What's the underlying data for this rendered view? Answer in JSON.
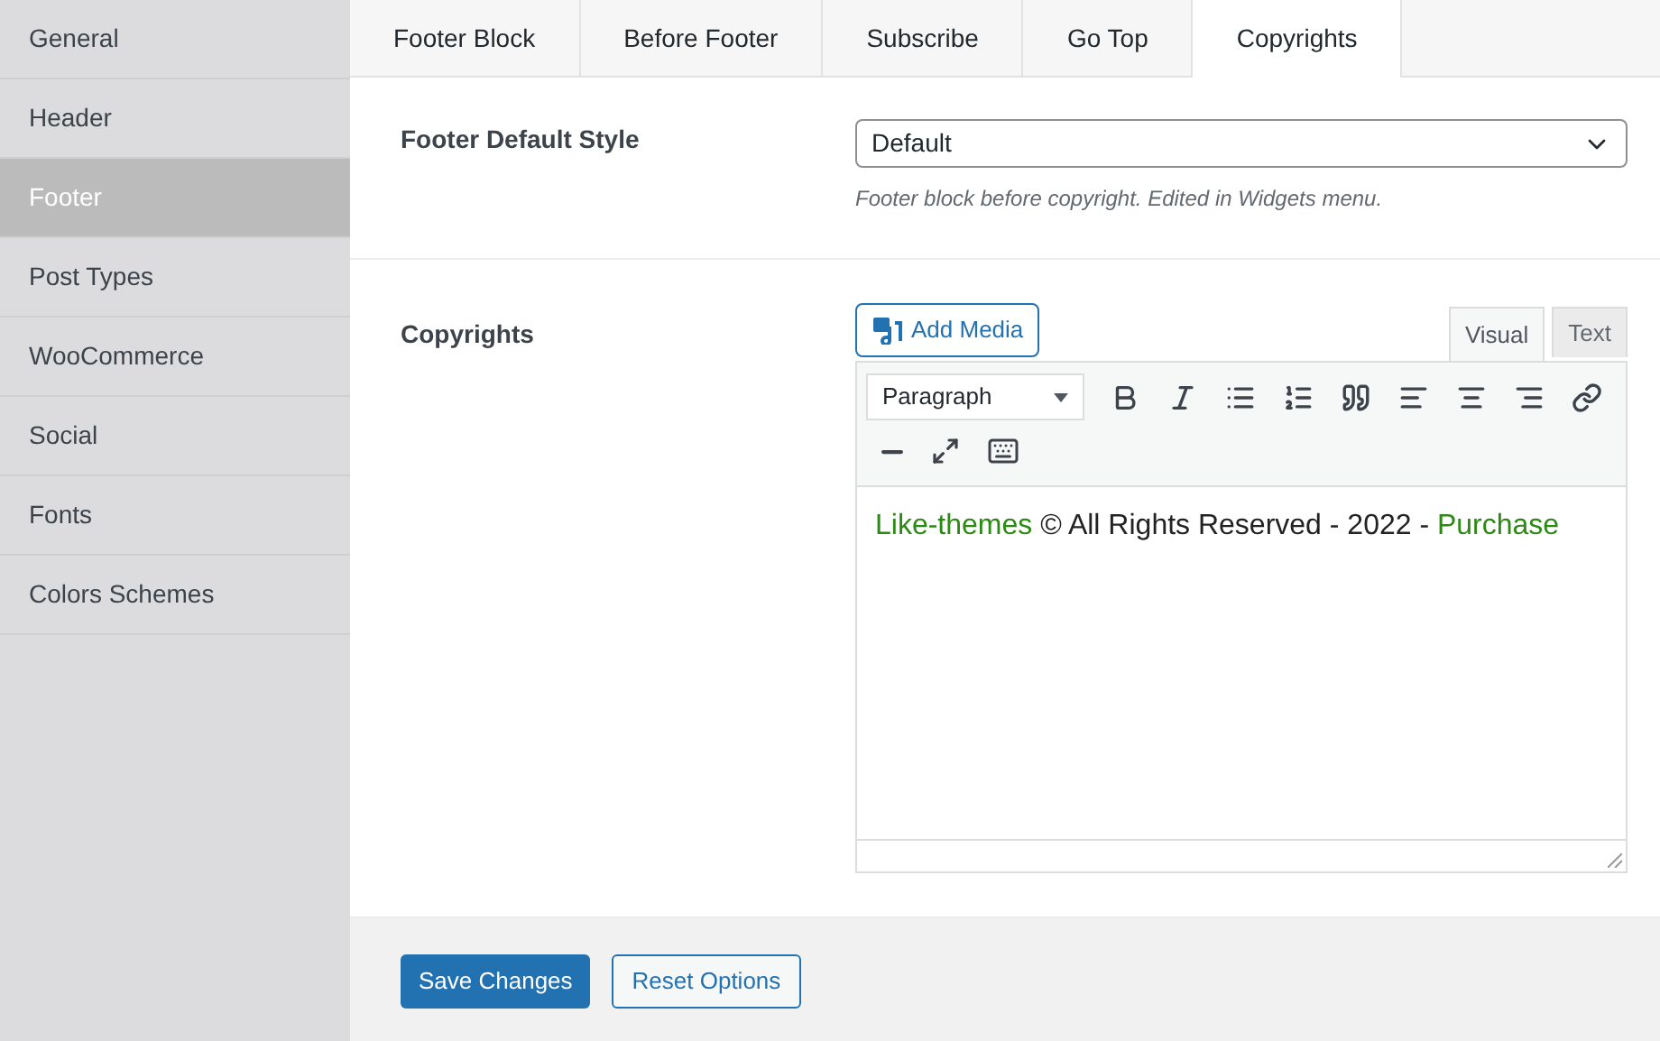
{
  "sidebar": {
    "items": [
      {
        "label": "General",
        "selected": false
      },
      {
        "label": "Header",
        "selected": false
      },
      {
        "label": "Footer",
        "selected": true
      },
      {
        "label": "Post Types",
        "selected": false
      },
      {
        "label": "WooCommerce",
        "selected": false
      },
      {
        "label": "Social",
        "selected": false
      },
      {
        "label": "Fonts",
        "selected": false
      },
      {
        "label": "Colors Schemes",
        "selected": false
      }
    ]
  },
  "tabs": [
    {
      "label": "Footer Block",
      "selected": false
    },
    {
      "label": "Before Footer",
      "selected": false
    },
    {
      "label": "Subscribe",
      "selected": false
    },
    {
      "label": "Go Top",
      "selected": false
    },
    {
      "label": "Copyrights",
      "selected": true
    }
  ],
  "footer_default_style": {
    "label": "Footer Default Style",
    "value": "Default",
    "description": "Footer block before copyright. Edited in Widgets menu."
  },
  "copyrights": {
    "label": "Copyrights",
    "add_media": "Add Media",
    "editor_tabs": [
      {
        "label": "Visual",
        "selected": true
      },
      {
        "label": "Text",
        "selected": false
      }
    ],
    "format": "Paragraph",
    "content": [
      {
        "kind": "link",
        "text": "Like-themes"
      },
      {
        "kind": "text",
        "text": " © All Rights Reserved - 2022 - "
      },
      {
        "kind": "link",
        "text": "Purchase"
      }
    ]
  },
  "buttons": {
    "save": "Save Changes",
    "reset": "Reset Options"
  }
}
